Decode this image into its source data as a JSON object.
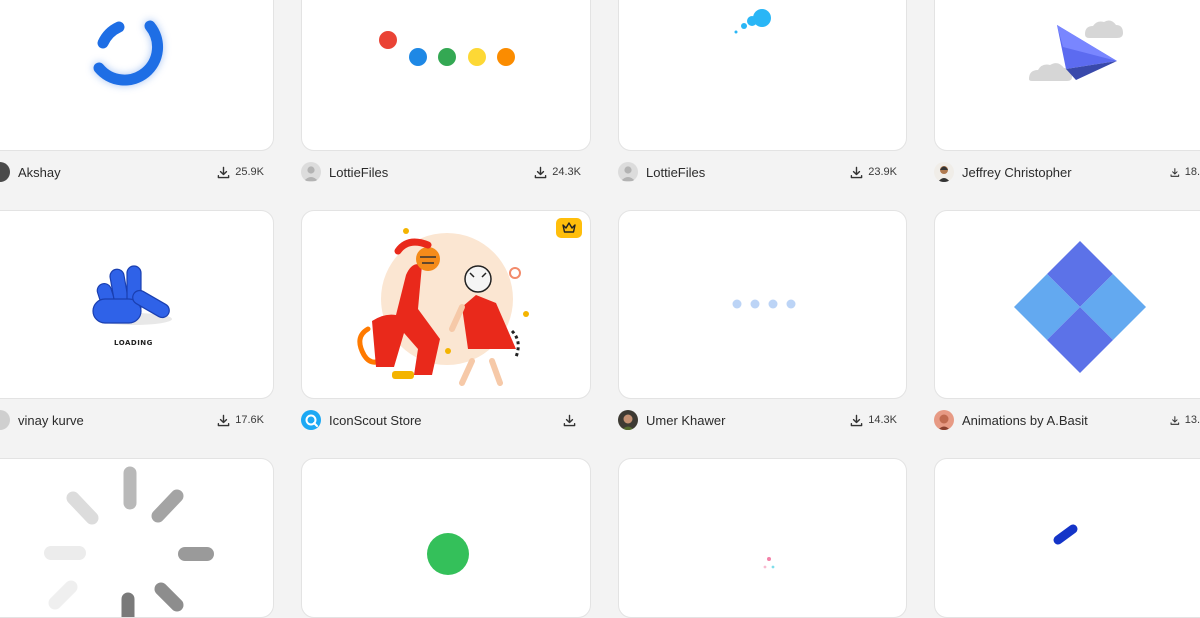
{
  "cards": [
    {
      "author": "Akshay",
      "downloads": "25.9K",
      "avatar_icon": "user-photo-icon"
    },
    {
      "author": "LottieFiles",
      "downloads": "24.3K",
      "avatar_icon": "default-avatar-icon"
    },
    {
      "author": "LottieFiles",
      "downloads": "23.9K",
      "avatar_icon": "default-avatar-icon"
    },
    {
      "author": "Jeffrey Christopher",
      "downloads": "18.",
      "avatar_icon": "user-photo-icon"
    },
    {
      "author": "vinay kurve",
      "downloads": "17.6K",
      "avatar_icon": "user-photo-icon",
      "art_caption": "LOADING"
    },
    {
      "author": "IconScout Store",
      "downloads": "",
      "avatar_icon": "iconscout-logo-icon",
      "premium_icon": "crown-icon"
    },
    {
      "author": "Umer Khawer",
      "downloads": "14.3K",
      "avatar_icon": "user-photo-icon"
    },
    {
      "author": "Animations by A.Basit",
      "downloads": "13.",
      "avatar_icon": "user-photo-icon"
    }
  ],
  "colors": {
    "page_bg": "#f3f3f3",
    "card_bg": "#ffffff",
    "text": "#2b2b2b",
    "premium": "#ffbe0b",
    "blue": "#1e6ee5",
    "google_red": "#ea4335",
    "google_blue": "#1e88e5",
    "google_green": "#34a853",
    "google_yellow": "#fdd835",
    "google_orange": "#fb8c00",
    "green_dot": "#34c05a"
  }
}
